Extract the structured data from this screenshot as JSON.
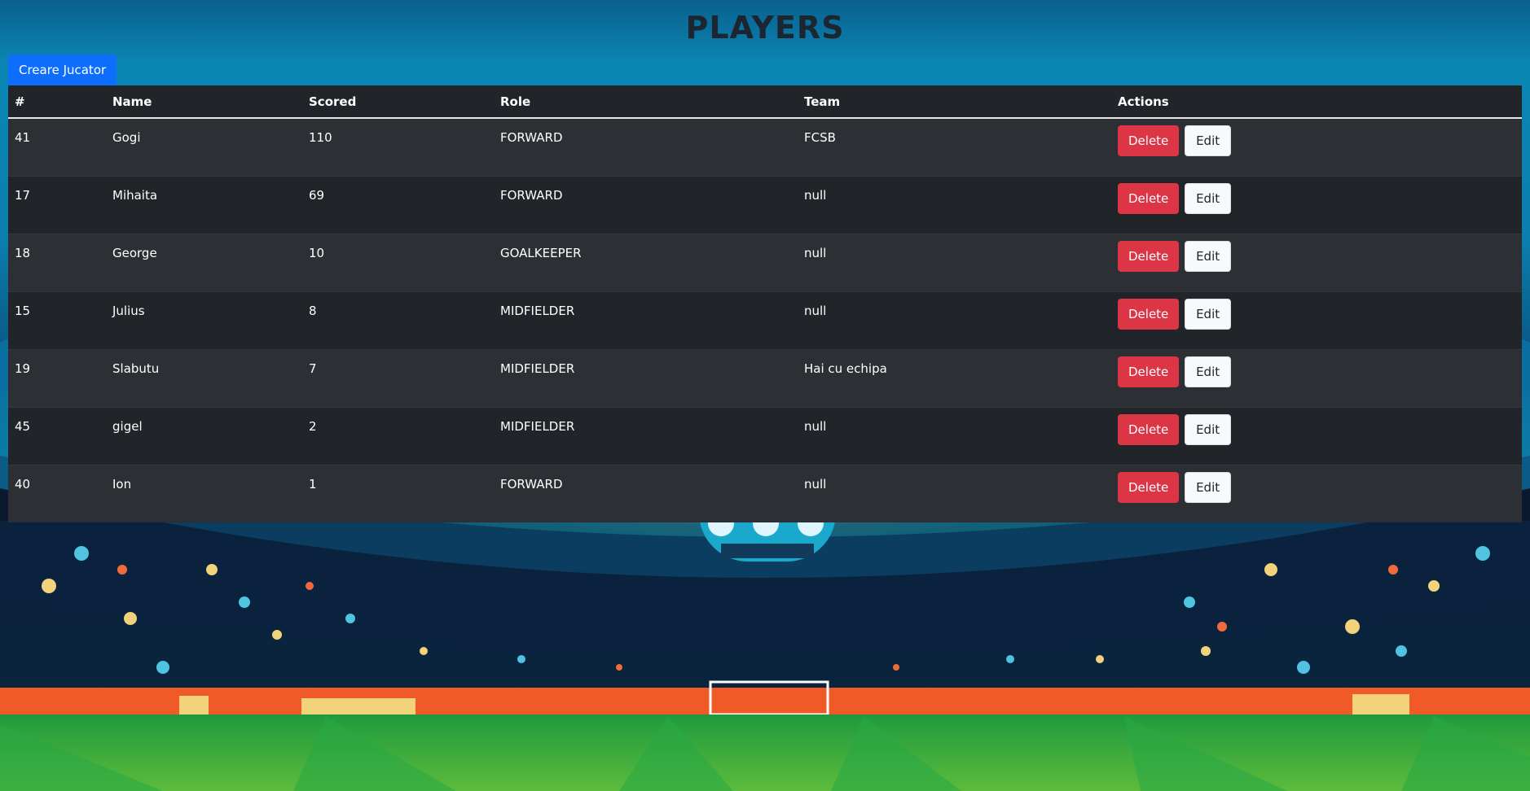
{
  "page": {
    "title": "PLAYERS"
  },
  "toolbar": {
    "create_label": "Creare Jucator"
  },
  "table": {
    "headers": [
      "#",
      "Name",
      "Scored",
      "Role",
      "Team",
      "Actions"
    ],
    "rows": [
      {
        "id": "41",
        "name": "Gogi",
        "scored": "110",
        "role": "FORWARD",
        "team": "FCSB"
      },
      {
        "id": "17",
        "name": "Mihaita",
        "scored": "69",
        "role": "FORWARD",
        "team": "null"
      },
      {
        "id": "18",
        "name": "George",
        "scored": "10",
        "role": "GOALKEEPER",
        "team": "null"
      },
      {
        "id": "15",
        "name": "Julius",
        "scored": "8",
        "role": "MIDFIELDER",
        "team": "null"
      },
      {
        "id": "19",
        "name": "Slabutu",
        "scored": "7",
        "role": "MIDFIELDER",
        "team": "Hai cu echipa"
      },
      {
        "id": "45",
        "name": "gigel",
        "scored": "2",
        "role": "MIDFIELDER",
        "team": "null"
      },
      {
        "id": "40",
        "name": "Ion",
        "scored": "1",
        "role": "FORWARD",
        "team": "null"
      }
    ],
    "delete_label": "Delete",
    "edit_label": "Edit"
  },
  "colors": {
    "primary": "#0d6efd",
    "danger": "#dc3545",
    "table_bg": "#212529",
    "title": "#1c2530"
  }
}
